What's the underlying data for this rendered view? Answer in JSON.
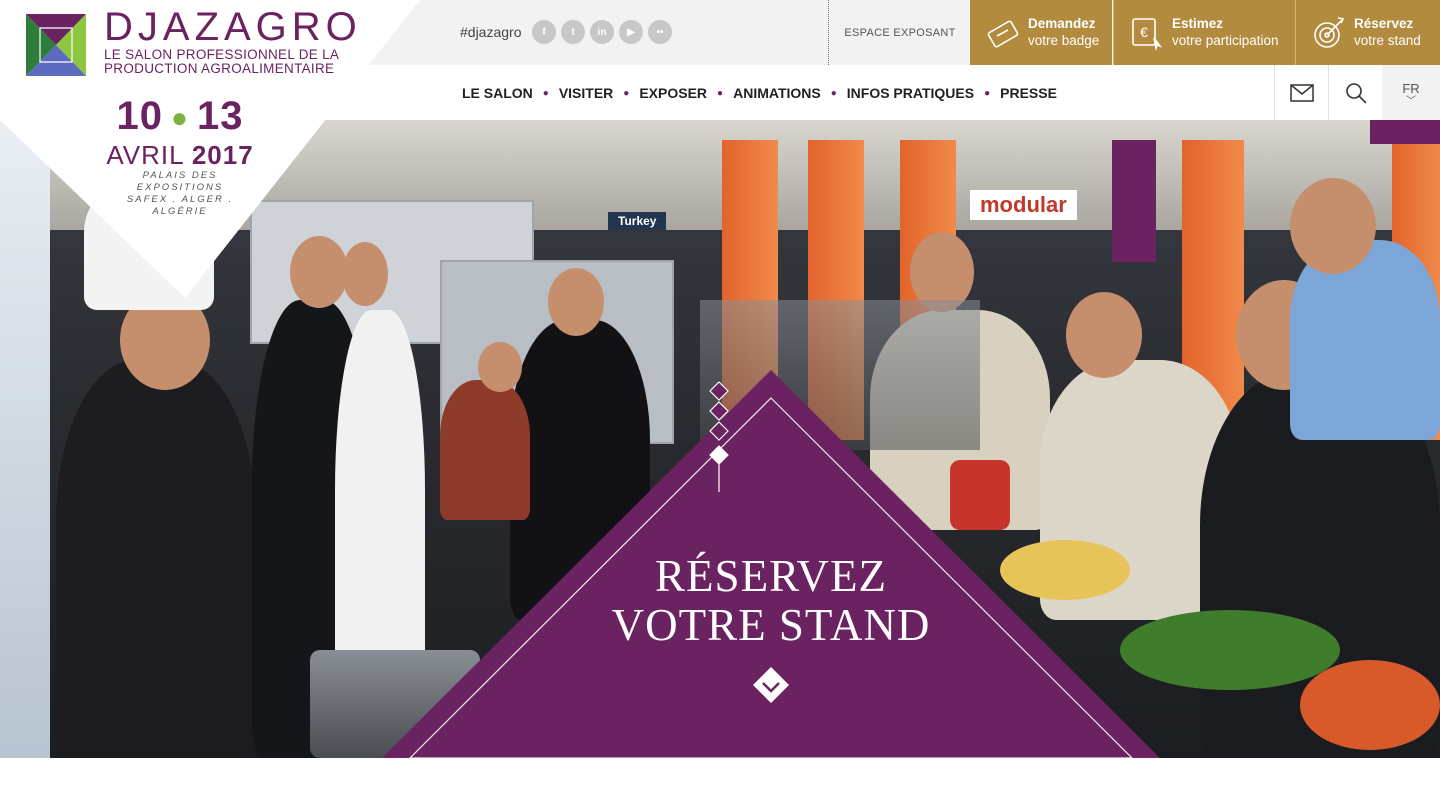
{
  "brand": {
    "name": "DJAZAGRO",
    "tagline_line1": "LE SALON PROFESSIONNEL DE LA",
    "tagline_line2": "PRODUCTION AGROALIMENTAIRE",
    "colors": {
      "purple": "#6b2260",
      "green": "#7cb342",
      "gold": "#b38b3e"
    }
  },
  "event": {
    "day_start": "10",
    "day_end": "13",
    "month": "AVRIL",
    "year": "2017",
    "venue_line1": "PALAIS DES EXPOSITIONS",
    "venue_line2": "SAFEX . ALGER . ALGÉRIE"
  },
  "topbar": {
    "hashtag": "#djazagro",
    "socials": [
      {
        "icon": "facebook-icon",
        "glyph": "f"
      },
      {
        "icon": "twitter-icon",
        "glyph": "t"
      },
      {
        "icon": "linkedin-icon",
        "glyph": "in"
      },
      {
        "icon": "youtube-icon",
        "glyph": "▶"
      },
      {
        "icon": "flickr-icon",
        "glyph": "••"
      }
    ],
    "espace_exposant": "ESPACE EXPOSANT",
    "cta": [
      {
        "title": "Demandez",
        "subtitle": "votre badge",
        "icon": "badge-icon"
      },
      {
        "title": "Estimez",
        "subtitle": "votre participation",
        "icon": "euro-icon"
      },
      {
        "title": "Réservez",
        "subtitle": "votre stand",
        "icon": "target-icon"
      }
    ]
  },
  "nav": {
    "items": [
      "LE SALON",
      "VISITER",
      "EXPOSER",
      "ANIMATIONS",
      "INFOS PRATIQUES",
      "PRESSE"
    ],
    "mail_icon": "mail-icon",
    "search_icon": "search-icon",
    "language": "FR"
  },
  "hero": {
    "cta_line1": "RÉSERVEZ",
    "cta_line2": "VOTRE STAND",
    "sign_text": "modular",
    "sign_text2": "Turkey"
  }
}
